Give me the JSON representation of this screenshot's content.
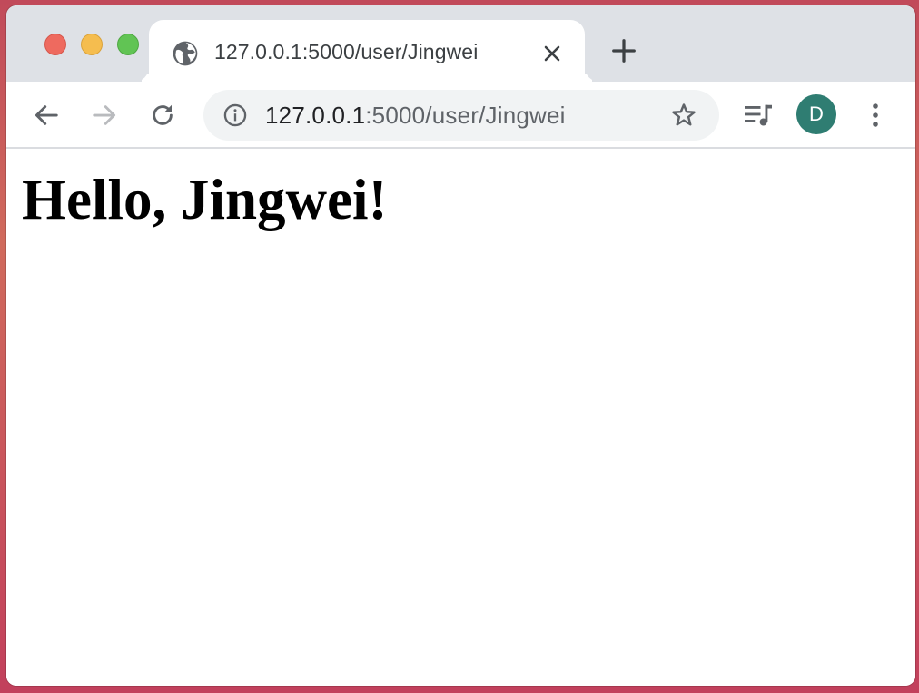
{
  "browser": {
    "tab": {
      "title": "127.0.0.1:5000/user/Jingwei",
      "favicon": "globe-icon"
    },
    "omnibox": {
      "url_host": "127.0.0.1",
      "url_path": ":5000/user/Jingwei"
    },
    "profile": {
      "initial": "D",
      "color": "#2f7d72"
    }
  },
  "page": {
    "heading": "Hello, Jingwei!"
  }
}
